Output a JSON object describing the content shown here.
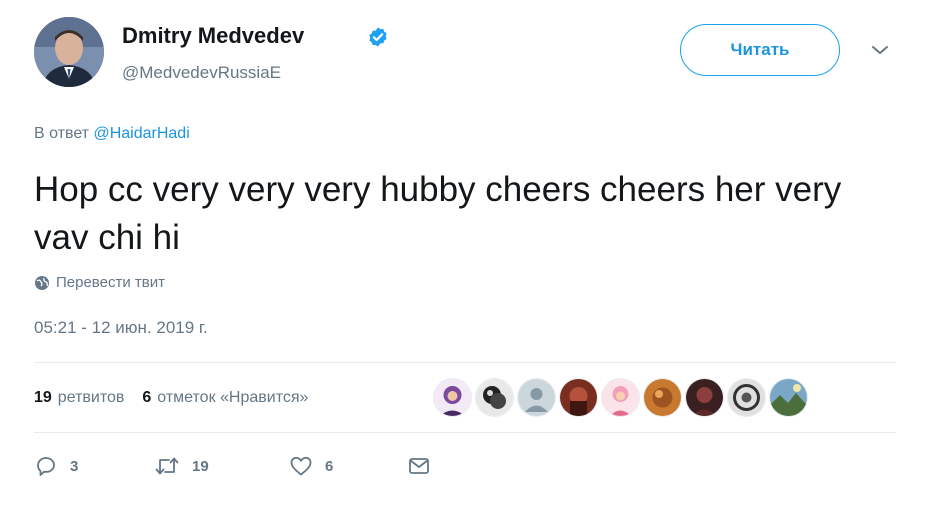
{
  "author": {
    "name": "Dmitry Medvedev",
    "handle": "@MedvedevRussiaE"
  },
  "follow_button_label": "Читать",
  "reply_to": {
    "prefix": "В ответ",
    "mention": "@HaidarHadi"
  },
  "tweet_text": "Hop cc very very very hubby cheers cheers her very vav chi hi",
  "translate_label": "Перевести твит",
  "timestamp": "05:21 - 12 июн. 2019 г.",
  "stats": {
    "retweets_count": "19",
    "retweets_label": "ретвитов",
    "likes_count": "6",
    "likes_label": "отметок «Нравится»"
  },
  "actions": {
    "reply_count": "3",
    "retweet_count": "19",
    "like_count": "6"
  },
  "colors": {
    "accent": "#1da1f2",
    "link": "#1b95e0",
    "muted": "#657786",
    "text": "#14171a",
    "divider": "#e6ecf0"
  },
  "icons": [
    "verified-badge-icon",
    "chevron-down-icon",
    "globe-icon",
    "reply-icon",
    "retweet-icon",
    "heart-icon",
    "message-icon"
  ]
}
